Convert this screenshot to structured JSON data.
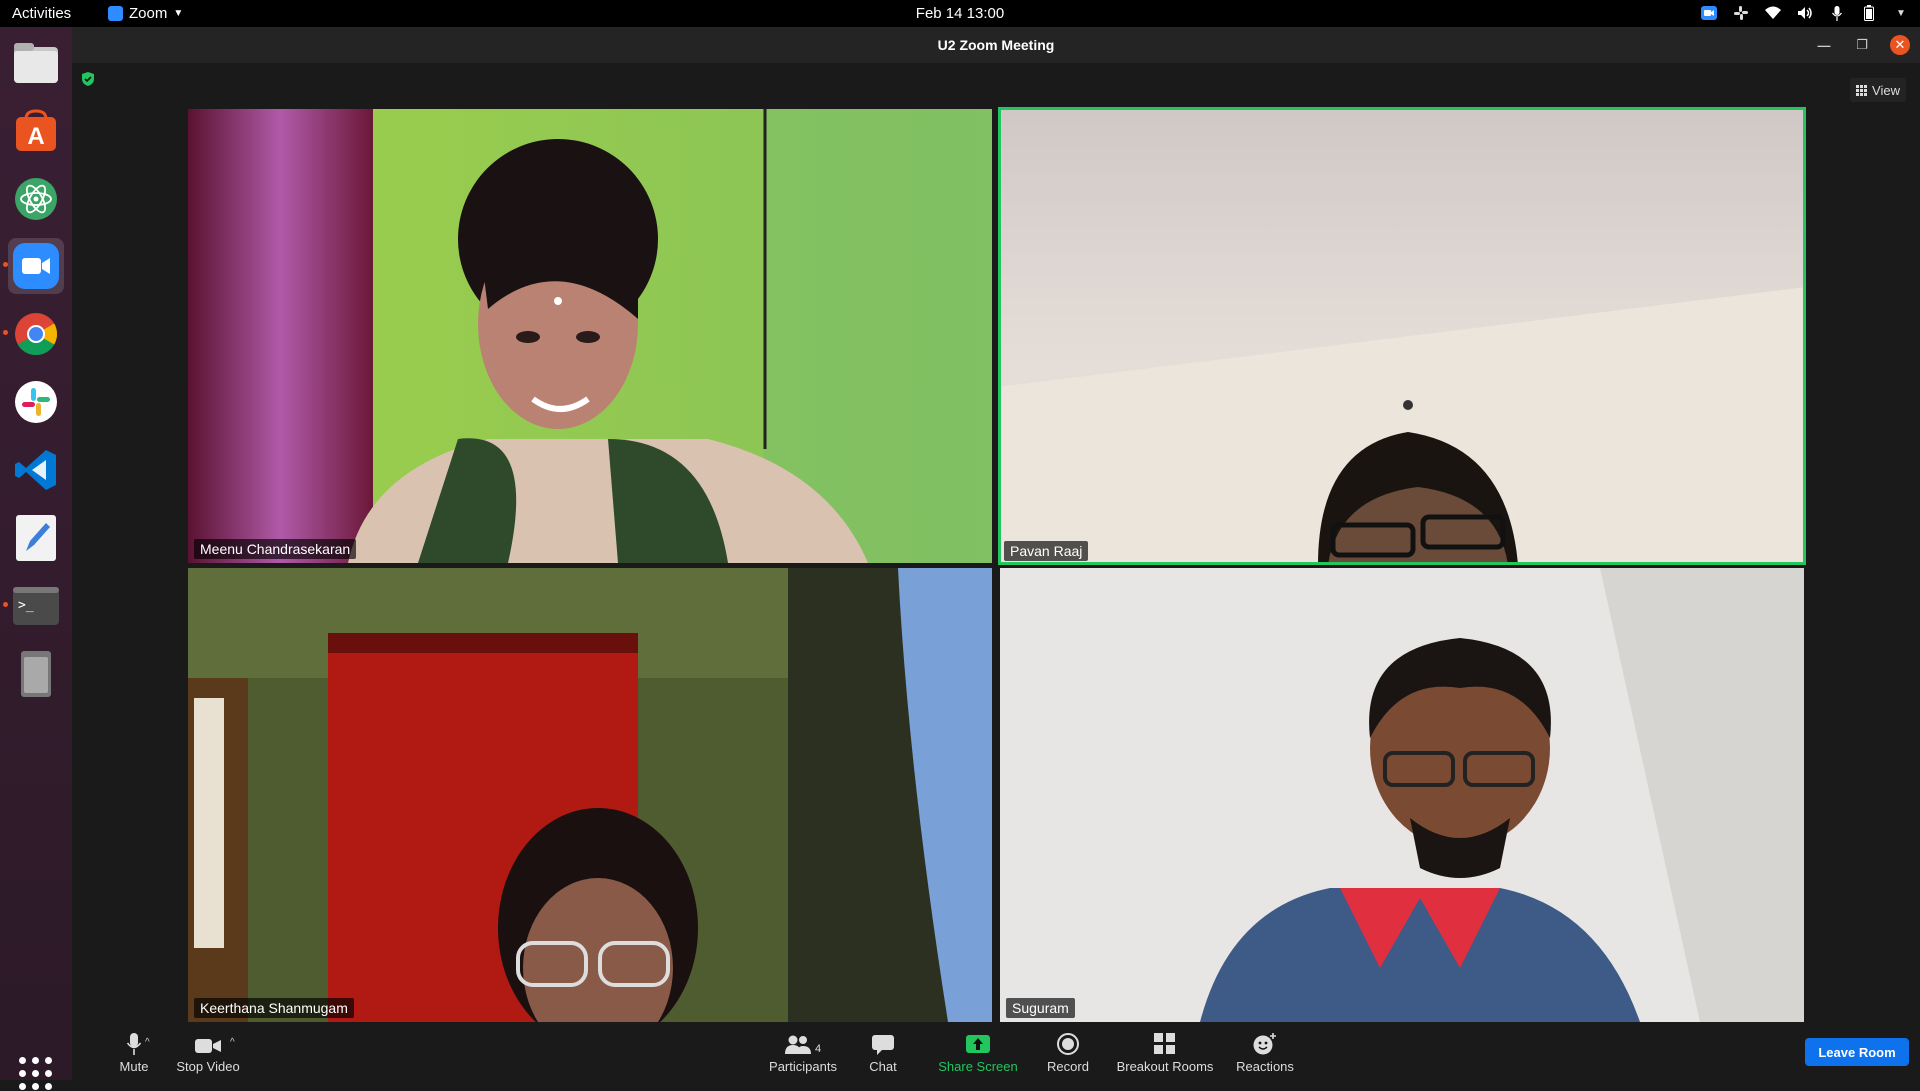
{
  "topbar": {
    "activities": "Activities",
    "app_menu": "Zoom",
    "clock": "Feb 14  13:00",
    "tray_icons": [
      "zoom-tray-icon",
      "slack-tray-icon",
      "wifi-icon",
      "volume-icon",
      "mic-icon",
      "battery-icon",
      "system-menu-icon"
    ]
  },
  "dock": {
    "items": [
      "files",
      "ubuntu-software",
      "atom",
      "zoom",
      "chrome",
      "slack",
      "vscode",
      "text-editor",
      "terminal",
      "removable-drive"
    ],
    "running": [
      "zoom",
      "chrome",
      "terminal"
    ],
    "active": "zoom"
  },
  "window": {
    "title": "U2  Zoom Meeting",
    "view_label": "View"
  },
  "participants": [
    {
      "name": "Meenu Chandrasekaran",
      "active_speaker": false
    },
    {
      "name": "Pavan Raaj",
      "active_speaker": true
    },
    {
      "name": "Keerthana Shanmugam",
      "active_speaker": false
    },
    {
      "name": "Suguram",
      "active_speaker": false
    }
  ],
  "toolbar": {
    "mute": "Mute",
    "stop_video": "Stop Video",
    "participants": "Participants",
    "participants_count": "4",
    "chat": "Chat",
    "share_screen": "Share Screen",
    "record": "Record",
    "breakout_rooms": "Breakout Rooms",
    "reactions": "Reactions",
    "leave": "Leave Room"
  },
  "colors": {
    "accent_green": "#22c55e",
    "zoom_blue": "#0e72ed",
    "ubuntu_orange": "#e95420"
  }
}
